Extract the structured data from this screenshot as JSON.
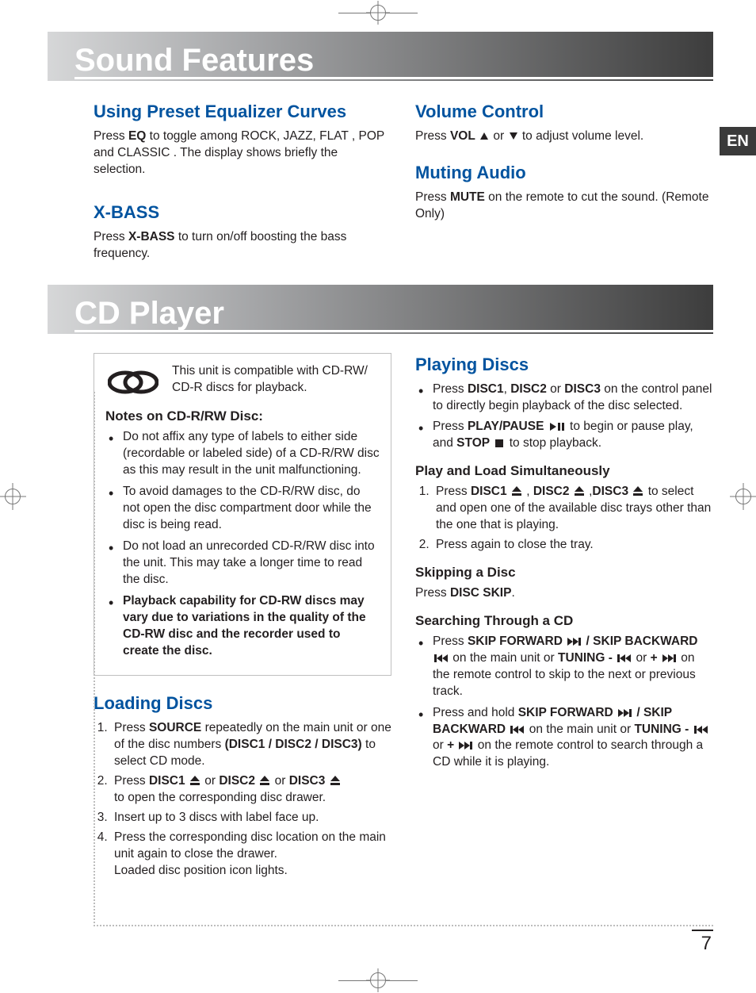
{
  "lang_tab": "EN",
  "page_number": "7",
  "section1": {
    "title": "Sound Features",
    "eq": {
      "heading": "Using Preset Equalizer Curves",
      "text_pre": "Press ",
      "btn": "EQ",
      "text_post": " to toggle among ROCK, JAZZ, FLAT , POP and  CLASSIC .  The display shows briefly the selection."
    },
    "xbass": {
      "heading": "X-BASS",
      "text_pre": "Press ",
      "btn": "X-BASS",
      "text_post": " to turn on/off boosting the bass frequency."
    },
    "volume": {
      "heading": "Volume Control",
      "text_pre": "Press ",
      "btn": "VOL",
      "mid": "   or  ",
      "text_post": "  to adjust volume level."
    },
    "mute": {
      "heading": "Muting Audio",
      "text_pre": "Press ",
      "btn": "MUTE",
      "text_post": " on the remote to cut the sound. (Remote Only)"
    }
  },
  "section2": {
    "title": "CD Player",
    "compat": "This unit is compatible with CD-RW/ CD-R discs for playback.",
    "notes_heading": "Notes on CD-R/RW Disc:",
    "notes": [
      "Do not affix any type of labels to either side (recordable or labeled side) of a CD-R/RW disc as this may result in the unit malfunctioning.",
      "To avoid damages to the CD-R/RW disc, do not open the disc compartment door while the disc is being read.",
      "Do not load an unrecorded CD-R/RW disc into the unit. This may take a longer time to read the disc."
    ],
    "notes_bold": "Playback capability for CD-RW discs may vary due to variations in the quality of the CD-RW disc and the recorder used to create the disc.",
    "loading": {
      "heading": "Loading Discs",
      "step1_pre": "Press ",
      "step1_btn": "SOURCE",
      "step1_mid": "  repeatedly on the main unit or one of the disc numbers ",
      "step1_bold": "(DISC1 / DISC2 / DISC3)",
      "step1_post": "  to select CD mode.",
      "step2_pre": "Press ",
      "d1": "DISC1",
      "or1": "  or ",
      "d2": "DISC2",
      "or2": "  or ",
      "d3": "DISC3",
      "step2_post": "to open the corresponding disc drawer.",
      "step3": "Insert up to 3 discs with label face up.",
      "step4a": "Press the corresponding disc location on the main unit again to close the drawer.",
      "step4b": "Loaded disc position icon lights."
    },
    "playing": {
      "heading": "Playing Discs",
      "b1_pre": "Press ",
      "b1_d1": "DISC1",
      "b1_c1": ", ",
      "b1_d2": "DISC2",
      "b1_or": " or ",
      "b1_d3": "DISC3",
      "b1_post": " on the control panel to directly begin playback of the disc selected.",
      "b2_pre": "Press ",
      "b2_pp": "PLAY/PAUSE",
      "b2_mid": " to begin or pause  play, and ",
      "b2_stop": "STOP",
      "b2_post": "  to stop playback."
    },
    "playload": {
      "heading": "Play and Load Simultaneously",
      "s1_pre": "Press ",
      "s1_d1": "DISC1",
      "s1_c1": "  , ",
      "s1_d2": "DISC2",
      "s1_c2": "  ,",
      "s1_d3": "DISC3",
      "s1_post": "  to select and open one of the available disc trays  other than the one that is playing.",
      "s2": "Press again  to close the tray."
    },
    "skip": {
      "heading": "Skipping a Disc",
      "text_pre": "Press ",
      "btn": "DISC SKIP",
      "text_post": "."
    },
    "search": {
      "heading": "Searching Through a CD",
      "b1_pre": "Press ",
      "b1_sf": "SKIP FORWARD",
      "b1_slash": "  / ",
      "b1_sb": "SKIP BACKWARD",
      "b1_mid1": "  on the main unit or ",
      "b1_tun": "TUNING -",
      "b1_or": "  or ",
      "b1_plus": "+",
      "b1_post": " on the remote control to skip to the next or previous  track.",
      "b2_pre": "Press and hold ",
      "b2_sf": "SKIP FORWARD",
      "b2_slash": "  / ",
      "b2_sb": "SKIP BACKWARD",
      "b2_mid1": "   on the main unit or ",
      "b2_tun": "TUNING -",
      "b2_or": "  or ",
      "b2_plus": "+",
      "b2_post": "  on the remote control to search through a CD while it is playing."
    }
  }
}
